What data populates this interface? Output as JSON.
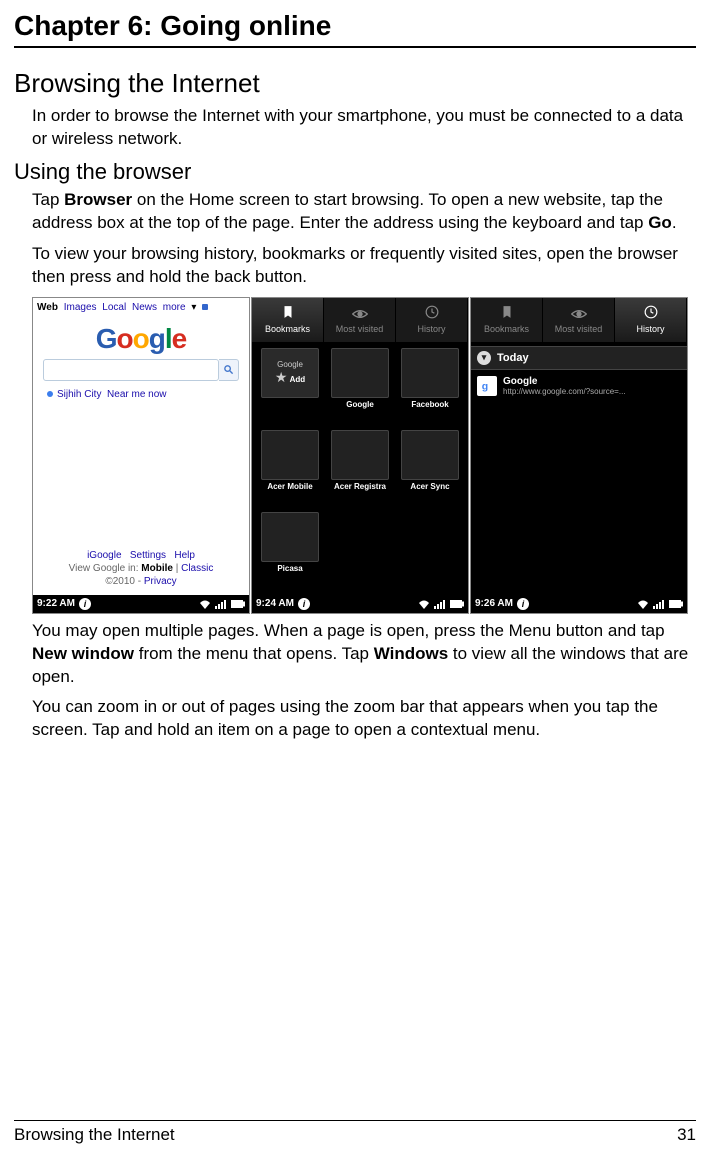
{
  "chapter_title": "Chapter 6: Going online",
  "section_title": "Browsing the Internet",
  "intro_para": "In order to browse the Internet with your smartphone, you must be connected to a data or wireless network.",
  "subsection_title": "Using the browser",
  "para2_pre": "Tap ",
  "para2_b1": "Browser",
  "para2_mid": " on the Home screen to start browsing. To open a new website, tap the address box at the top of the page. Enter the address using the keyboard and tap ",
  "para2_b2": "Go",
  "para2_end": ".",
  "para3": "To view your browsing history, bookmarks or frequently visited sites, open the browser then press and hold the back button.",
  "para4_pre": "You may open multiple pages. When a page is open, press the Menu button and tap ",
  "para4_b1": "New window",
  "para4_mid": " from the menu that opens. Tap ",
  "para4_b2": "Windows",
  "para4_end": " to view all the windows that are open.",
  "para5": "You can zoom in or out of pages using the zoom bar that appears when you tap the screen. Tap and hold an item on a page to open a contextual menu.",
  "footer_left": "Browsing the Internet",
  "footer_right": "31",
  "screen1": {
    "nav": {
      "web": "Web",
      "images": "Images",
      "local": "Local",
      "news": "News",
      "more": "more"
    },
    "location_city": "Sijhih City",
    "near_me": "Near me now",
    "igooogle": "iGoogle",
    "settings": "Settings",
    "help": "Help",
    "view_in": "View Google in: ",
    "mobile": "Mobile",
    "classic": "Classic",
    "copyright": "©2010 - ",
    "privacy": "Privacy",
    "status_time": "9:22 AM"
  },
  "screen2": {
    "tab_bookmarks": "Bookmarks",
    "tab_most": "Most visited",
    "tab_history": "History",
    "add": "Add",
    "bm1": "Google",
    "bm2": "Facebook",
    "bm3": "Acer Mobile",
    "bm4": "Acer Registra",
    "bm5": "Acer Sync",
    "bm6": "Picasa",
    "status_time": "9:24 AM"
  },
  "screen3": {
    "tab_bookmarks": "Bookmarks",
    "tab_most": "Most visited",
    "tab_history": "History",
    "today": "Today",
    "item_title": "Google",
    "item_url": "http://www.google.com/?source=...",
    "status_time": "9:26 AM"
  }
}
